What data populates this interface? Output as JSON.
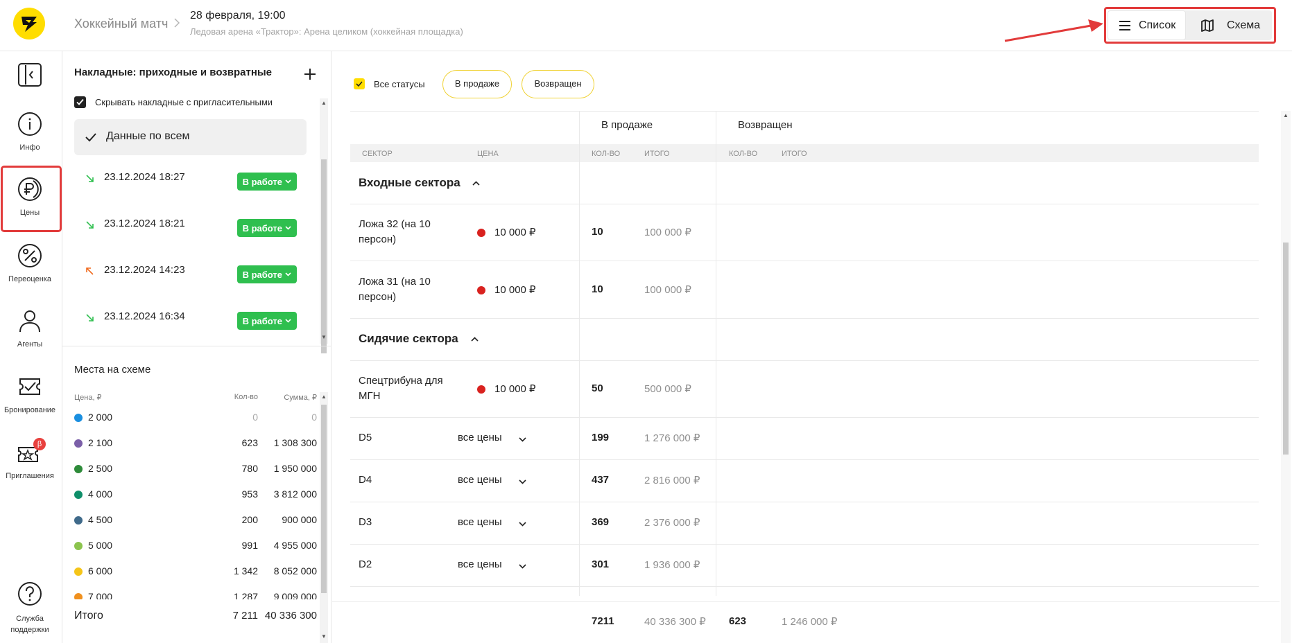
{
  "header": {
    "breadcrumb": "Хоккейный матч",
    "date": "28 февраля, 19:00",
    "venue": "Ледовая арена «Трактор»: Арена целиком (хоккейная площадка)",
    "view_list": "Список",
    "view_map": "Схема"
  },
  "sidebar": {
    "items": [
      {
        "label": "Инфо",
        "icon": "info-icon"
      },
      {
        "label": "Цены",
        "icon": "ruble-icon"
      },
      {
        "label": "Переоценка",
        "icon": "percent-icon"
      },
      {
        "label": "Агенты",
        "icon": "person-icon"
      },
      {
        "label": "Бронирование",
        "icon": "ticket-check-icon"
      },
      {
        "label": "Приглашения",
        "icon": "tickets-icon",
        "badge": "β"
      },
      {
        "label": "Служба поддержки",
        "icon": "help-icon"
      }
    ]
  },
  "invoices": {
    "title": "Накладные: приходные и возвратные",
    "hide_label": "Скрывать накладные с пригласительными",
    "all_label": "Данные по всем",
    "items": [
      {
        "date": "23.12.2024 18:27",
        "status": "В работе",
        "dir": "in"
      },
      {
        "date": "23.12.2024 18:21",
        "status": "В работе",
        "dir": "in"
      },
      {
        "date": "23.12.2024 14:23",
        "status": "В работе",
        "dir": "out"
      },
      {
        "date": "23.12.2024 16:34",
        "status": "В работе",
        "dir": "in"
      }
    ]
  },
  "places": {
    "title": "Места на схеме",
    "col_price": "Цена, ₽",
    "col_count": "Кол-во",
    "col_sum": "Сумма, ₽",
    "rows": [
      {
        "price": "2 000",
        "count": "0",
        "sum": "0",
        "color": "#1a8fe0"
      },
      {
        "price": "2 100",
        "count": "623",
        "sum": "1 308 300",
        "color": "#7b5fa8"
      },
      {
        "price": "2 500",
        "count": "780",
        "sum": "1 950 000",
        "color": "#2e8b3a"
      },
      {
        "price": "4 000",
        "count": "953",
        "sum": "3 812 000",
        "color": "#0f8f6a"
      },
      {
        "price": "4 500",
        "count": "200",
        "sum": "900 000",
        "color": "#3f6a8a"
      },
      {
        "price": "5 000",
        "count": "991",
        "sum": "4 955 000",
        "color": "#8cc44e"
      },
      {
        "price": "6 000",
        "count": "1 342",
        "sum": "8 052 000",
        "color": "#f5c518"
      },
      {
        "price": "7 000",
        "count": "1 287",
        "sum": "9 009 000",
        "color": "#f0901e"
      }
    ],
    "total_label": "Итого",
    "total_count": "7 211",
    "total_sum": "40 336 300"
  },
  "filters": {
    "all": "Все статусы",
    "on_sale": "В продаже",
    "returned": "Возвращен"
  },
  "table": {
    "group_on_sale": "В продаже",
    "group_returned": "Возвращен",
    "col_sector": "СЕКТОР",
    "col_price": "ЦЕНА",
    "col_qty": "КОЛ-ВО",
    "col_total": "ИТОГО",
    "col_qty2": "КОЛ-ВО",
    "col_total2": "ИТОГО",
    "section1": "Входные сектора",
    "section2": "Сидячие сектора",
    "rows1": [
      {
        "sector": "Ложа 32 (на 10 персон)",
        "price": "10 000 ₽",
        "qty": "10",
        "total": "100 000 ₽"
      },
      {
        "sector": "Ложа 31 (на 10 персон)",
        "price": "10 000 ₽",
        "qty": "10",
        "total": "100 000 ₽"
      }
    ],
    "rows2": [
      {
        "sector": "Спецтрибуна для МГН",
        "price": "10 000 ₽",
        "qty": "50",
        "total": "500 000 ₽",
        "dot": true
      },
      {
        "sector": "D5",
        "price": "все цены",
        "qty": "199",
        "total": "1 276 000 ₽"
      },
      {
        "sector": "D4",
        "price": "все цены",
        "qty": "437",
        "total": "2 816 000 ₽"
      },
      {
        "sector": "D3",
        "price": "все цены",
        "qty": "369",
        "total": "2 376 000 ₽"
      },
      {
        "sector": "D2",
        "price": "все цены",
        "qty": "301",
        "total": "1 936 000 ₽"
      }
    ],
    "footer": {
      "qty": "7211",
      "total": "40 336 300 ₽",
      "qty2": "623",
      "total2": "1 246 000 ₽"
    }
  }
}
